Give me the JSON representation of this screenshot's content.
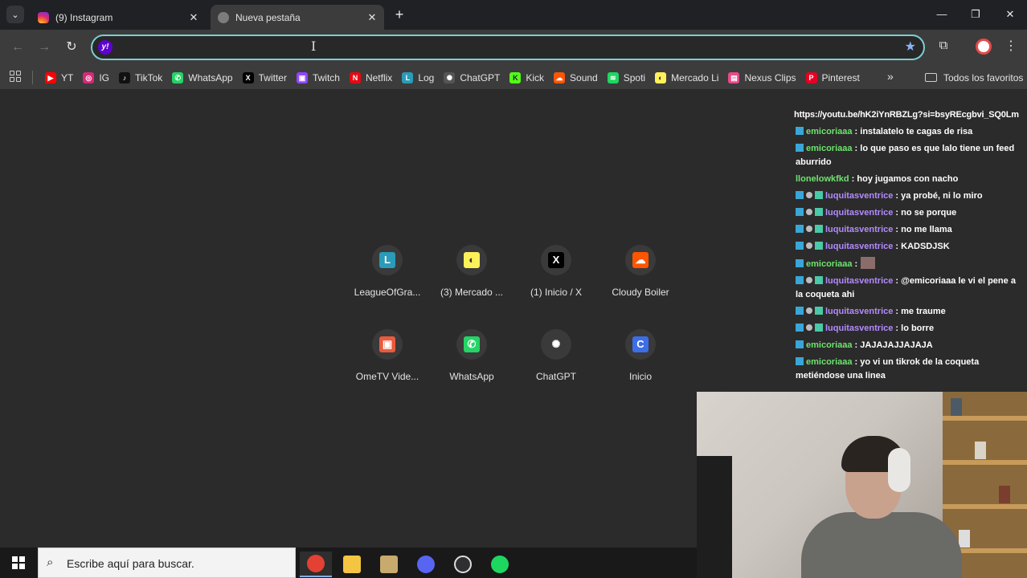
{
  "tabs": {
    "menu_icon": "chevron-down-icon",
    "items": [
      {
        "title": "(9) Instagram",
        "icon": "instagram-icon",
        "active": false
      },
      {
        "title": "Nueva pestaña",
        "icon": "globe-icon",
        "active": true
      }
    ],
    "close_glyph": "✕",
    "new_tab_glyph": "+"
  },
  "window_controls": {
    "minimize": "—",
    "maximize": "❐",
    "close": "✕"
  },
  "toolbar": {
    "back": "←",
    "forward": "→",
    "reload": "↻",
    "omnibox_value": "",
    "omnibox_icon": "yahoo-icon",
    "star": "★",
    "kebab": "⋮"
  },
  "bookmarks": {
    "items": [
      {
        "label": "YT",
        "color": "#ff0000",
        "glyph": "▶"
      },
      {
        "label": "IG",
        "color": "#d62976",
        "glyph": "◎"
      },
      {
        "label": "TikTok",
        "color": "#111111",
        "glyph": "♪"
      },
      {
        "label": "WhatsApp",
        "color": "#25d366",
        "glyph": "✆"
      },
      {
        "label": "Twitter",
        "color": "#000000",
        "glyph": "X"
      },
      {
        "label": "Twitch",
        "color": "#9146ff",
        "glyph": "▣"
      },
      {
        "label": "Netflix",
        "color": "#e50914",
        "glyph": "N"
      },
      {
        "label": "Log",
        "color": "#2a9bb8",
        "glyph": "L"
      },
      {
        "label": "ChatGPT",
        "color": "#555555",
        "glyph": "✺"
      },
      {
        "label": "Kick",
        "color": "#53fc18",
        "glyph": "K"
      },
      {
        "label": "Sound",
        "color": "#ff5500",
        "glyph": "☁"
      },
      {
        "label": "Spoti",
        "color": "#1ed760",
        "glyph": "≋"
      },
      {
        "label": "Mercado Li",
        "color": "#fff159",
        "glyph": "◐"
      },
      {
        "label": "Nexus Clips",
        "color": "#e84a8a",
        "glyph": "▤"
      },
      {
        "label": "Pinterest",
        "color": "#e60023",
        "glyph": "P"
      }
    ],
    "more": "»",
    "folder_label": "Todos los favoritos"
  },
  "shortcuts": [
    {
      "label": "LeagueOfGra...",
      "glyph": "L",
      "color": "#2a9bb8"
    },
    {
      "label": "(3) Mercado ...",
      "glyph": "◐",
      "color": "#fff159"
    },
    {
      "label": "(1) Inicio / X",
      "glyph": "X",
      "color": "#000000"
    },
    {
      "label": "Cloudy Boiler",
      "glyph": "☁",
      "color": "#ff5500"
    },
    {
      "label": "OmeTV Vide...",
      "glyph": "▣",
      "color": "#ea5a3d"
    },
    {
      "label": "WhatsApp",
      "glyph": "✆",
      "color": "#25d366"
    },
    {
      "label": "ChatGPT",
      "glyph": "✺",
      "color": "#3a3a3a"
    },
    {
      "label": "Inicio",
      "glyph": "C",
      "color": "#3b6ee8"
    }
  ],
  "chat": {
    "url": "https://youtu.be/hK2iYnRBZLg?si=bsyREcgbvi_SQ0Lm",
    "messages": [
      {
        "user": "emicoriaaa",
        "color": "#6ee36e",
        "text": ": instalatelo te cagas de risa",
        "badges": 1
      },
      {
        "user": "emicoriaaa",
        "color": "#6ee36e",
        "text": ": lo que paso es que lalo tiene un feed aburrido",
        "badges": 1
      },
      {
        "user": "llonelowkfkd",
        "color": "#6ee36e",
        "text": ": hoy jugamos con nacho",
        "badges": 0
      },
      {
        "user": "luquitasventrice",
        "color": "#b38bff",
        "text": ": ya probé, ni lo miro",
        "badges": 3
      },
      {
        "user": "luquitasventrice",
        "color": "#b38bff",
        "text": ": no se porque",
        "badges": 3
      },
      {
        "user": "luquitasventrice",
        "color": "#b38bff",
        "text": ": no me llama",
        "badges": 3
      },
      {
        "user": "luquitasventrice",
        "color": "#b38bff",
        "text": ": KADSDJSK",
        "badges": 3
      },
      {
        "user": "emicoriaaa",
        "color": "#6ee36e",
        "text": ":",
        "badges": 1,
        "emote": true
      },
      {
        "user": "luquitasventrice",
        "color": "#b38bff",
        "text": ": @emicoriaaa le vi el pene a la coqueta ahi",
        "badges": 3
      },
      {
        "user": "luquitasventrice",
        "color": "#b38bff",
        "text": ": me traume",
        "badges": 3
      },
      {
        "user": "luquitasventrice",
        "color": "#b38bff",
        "text": ": lo borre",
        "badges": 3
      },
      {
        "user": "emicoriaaa",
        "color": "#6ee36e",
        "text": ": JAJAJAJJAJAJA",
        "badges": 1
      },
      {
        "user": "emicoriaaa",
        "color": "#6ee36e",
        "text": ": yo vi un tikrok de la coqueta metiéndose una linea",
        "badges": 1
      }
    ]
  },
  "taskbar": {
    "search_placeholder": "Escribe aquí para buscar.",
    "apps": [
      {
        "name": "chrome-icon",
        "color": "#e34133",
        "active": true
      },
      {
        "name": "file-explorer-icon",
        "color": "#f4c542",
        "active": false
      },
      {
        "name": "league-client-icon",
        "color": "#c8aa6e",
        "active": false
      },
      {
        "name": "discord-icon",
        "color": "#5865f2",
        "active": false
      },
      {
        "name": "obs-icon",
        "color": "#302e31",
        "active": false
      },
      {
        "name": "spotify-icon",
        "color": "#1ed760",
        "active": false
      }
    ]
  }
}
